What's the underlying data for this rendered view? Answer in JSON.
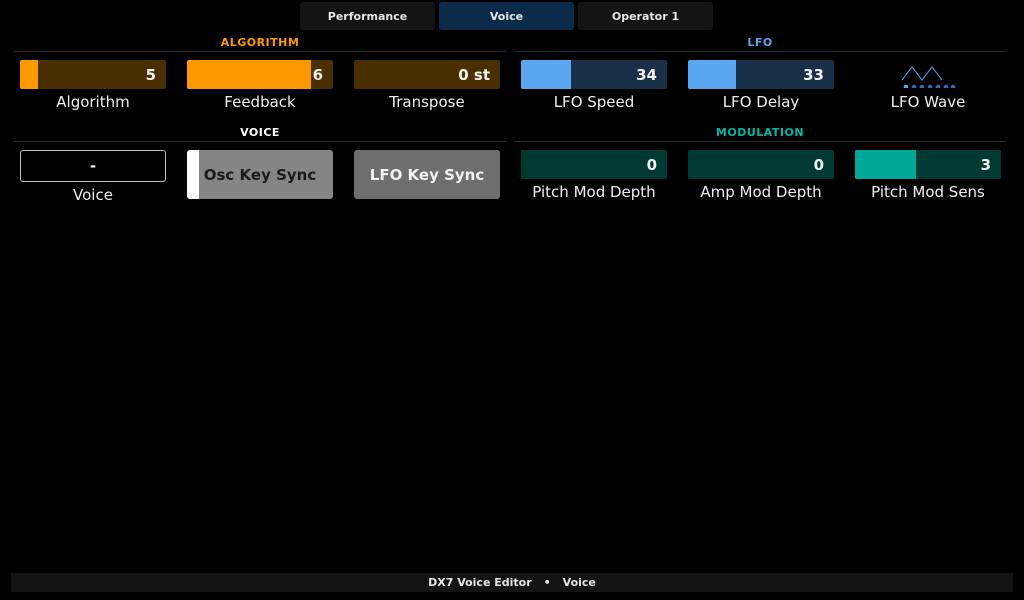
{
  "tabs": [
    {
      "label": "Performance",
      "active": false
    },
    {
      "label": "Voice",
      "active": true
    },
    {
      "label": "Operator 1",
      "active": false
    }
  ],
  "sections": {
    "algorithm": {
      "title": "ALGORITHM",
      "color": "#ff9900"
    },
    "lfo": {
      "title": "LFO",
      "color": "#5aa7f0"
    },
    "voice": {
      "title": "VOICE",
      "color": "#ffffff"
    },
    "modulation": {
      "title": "MODULATION",
      "color": "#00b7a8"
    }
  },
  "controls": {
    "algorithm": {
      "label": "Algorithm",
      "value": "5",
      "fill": 0.12
    },
    "feedback": {
      "label": "Feedback",
      "value": "6",
      "fill": 0.85
    },
    "transpose": {
      "label": "Transpose",
      "value": "0 st",
      "fill": 0
    },
    "lfo_speed": {
      "label": "LFO Speed",
      "value": "34",
      "fill": 0.34
    },
    "lfo_delay": {
      "label": "LFO Delay",
      "value": "33",
      "fill": 0.33
    },
    "lfo_wave": {
      "label": "LFO Wave",
      "icon": "triangle-wave-icon"
    },
    "voice": {
      "label": "Voice",
      "value": "-"
    },
    "osc_key_sync": {
      "label": "Osc Key Sync",
      "on": true
    },
    "lfo_key_sync": {
      "label": "LFO Key Sync",
      "on": false
    },
    "pitch_mod_depth": {
      "label": "Pitch Mod Depth",
      "value": "0",
      "fill": 0
    },
    "amp_mod_depth": {
      "label": "Amp Mod Depth",
      "value": "0",
      "fill": 0
    },
    "pitch_mod_sens": {
      "label": "Pitch Mod Sens",
      "value": "3",
      "fill": 0.42
    }
  },
  "footer": {
    "app": "DX7 Voice Editor",
    "separator": "•",
    "page": "Voice"
  }
}
